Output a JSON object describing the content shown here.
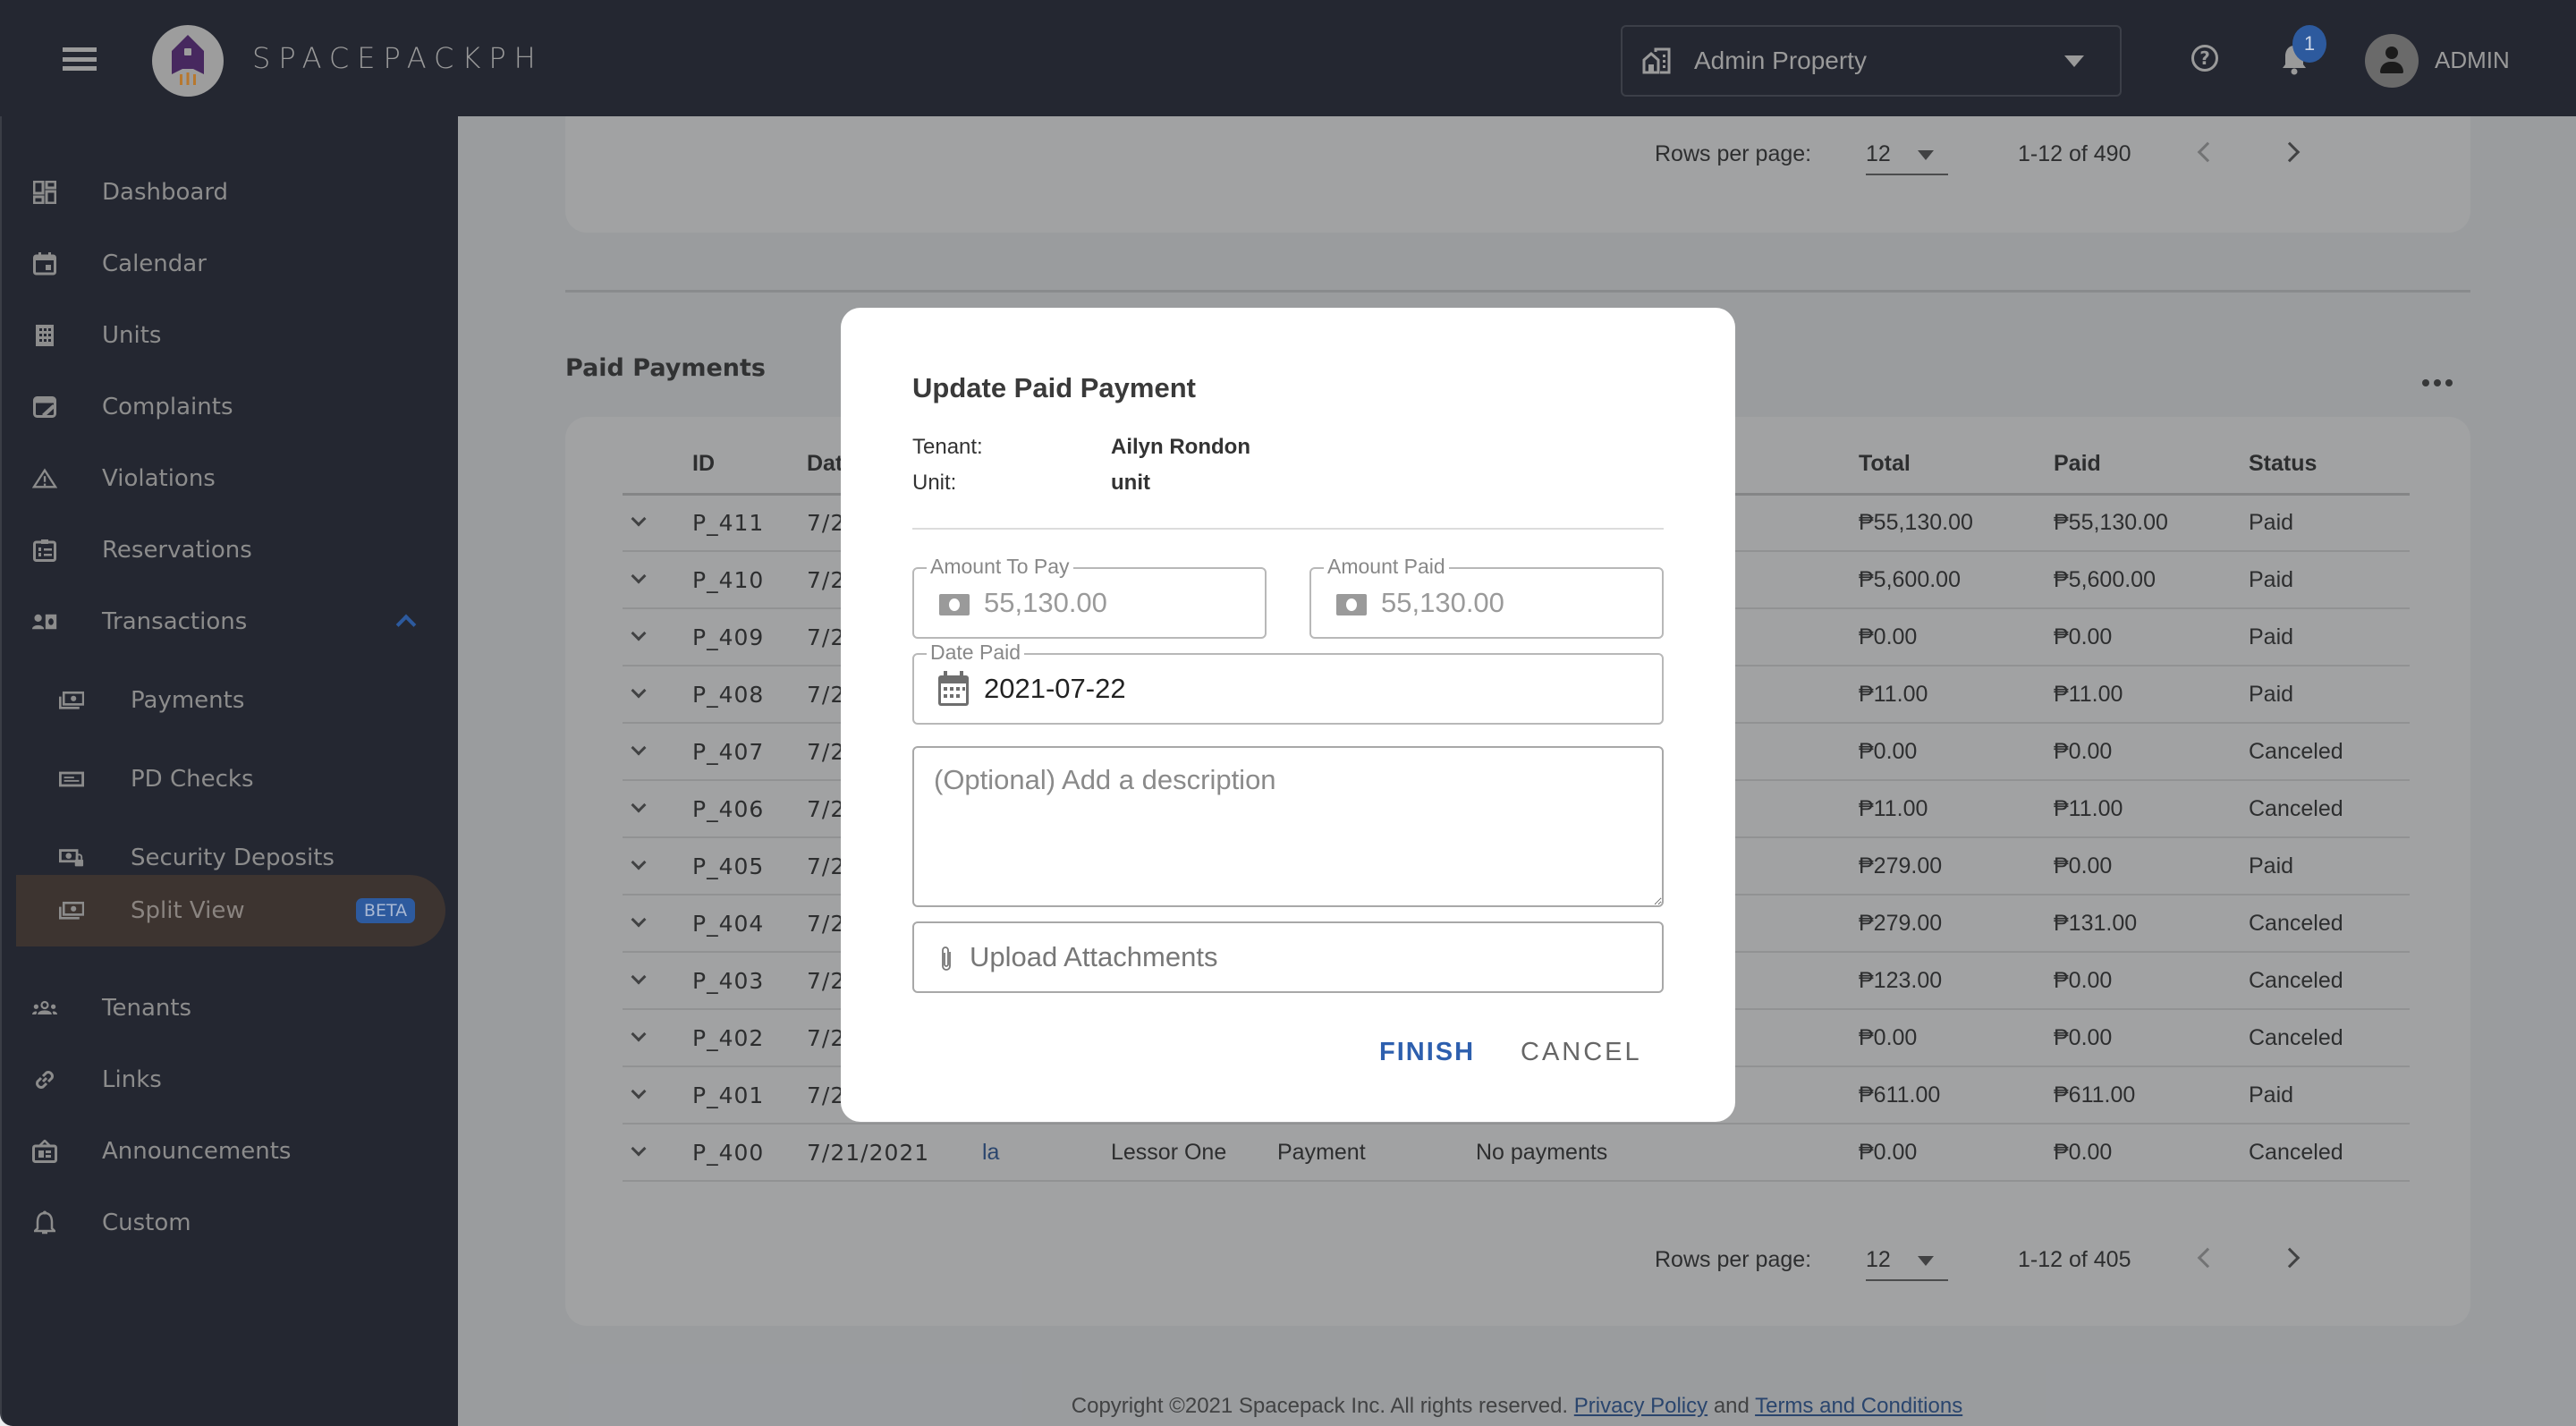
{
  "header": {
    "brand": "SPACEPACKPH",
    "property_selector": "Admin Property",
    "help_icon": "help-circle-icon",
    "notification_count": "1",
    "user_label": "ADMIN"
  },
  "sidebar": {
    "items": [
      {
        "label": "Dashboard",
        "icon": "dashboard-icon"
      },
      {
        "label": "Calendar",
        "icon": "calendar-icon"
      },
      {
        "label": "Units",
        "icon": "building-icon"
      },
      {
        "label": "Complaints",
        "icon": "edit-note-icon"
      },
      {
        "label": "Violations",
        "icon": "warning-icon"
      },
      {
        "label": "Reservations",
        "icon": "clipboard-list-icon"
      },
      {
        "label": "Transactions",
        "icon": "person-cash-icon",
        "expanded": true
      },
      {
        "label": "Payments",
        "icon": "cash-stack-icon",
        "sub": true
      },
      {
        "label": "PD Checks",
        "icon": "check-card-icon",
        "sub": true
      },
      {
        "label": "Security Deposits",
        "icon": "cash-lock-icon",
        "sub": true
      },
      {
        "label": "Split View",
        "icon": "cash-stack-icon",
        "sub": true,
        "active": true,
        "badge": "BETA"
      },
      {
        "label": "Tenants",
        "icon": "group-icon"
      },
      {
        "label": "Links",
        "icon": "link-icon"
      },
      {
        "label": "Announcements",
        "icon": "board-icon"
      },
      {
        "label": "Custom",
        "icon": "bell-icon"
      }
    ]
  },
  "top_pagination": {
    "rows_per_page_label": "Rows per page:",
    "rows_per_page": "12",
    "range": "1-12 of 490"
  },
  "paid_payments": {
    "title": "Paid Payments",
    "columns": [
      "",
      "ID",
      "Dat",
      "",
      "",
      "",
      "",
      "Total",
      "Paid",
      "Status"
    ],
    "rows": [
      {
        "id": "P_411",
        "date": "7/2",
        "c3": "",
        "c4": "",
        "c5": "",
        "c6": "",
        "total": "₱55,130.00",
        "paid": "₱55,130.00",
        "status": "Paid"
      },
      {
        "id": "P_410",
        "date": "7/2",
        "c3": "",
        "c4": "",
        "c5": "",
        "c6": "",
        "total": "₱5,600.00",
        "paid": "₱5,600.00",
        "status": "Paid"
      },
      {
        "id": "P_409",
        "date": "7/2",
        "c3": "",
        "c4": "",
        "c5": "",
        "c6": "",
        "total": "₱0.00",
        "paid": "₱0.00",
        "status": "Paid"
      },
      {
        "id": "P_408",
        "date": "7/2",
        "c3": "",
        "c4": "",
        "c5": "",
        "c6": "",
        "total": "₱11.00",
        "paid": "₱11.00",
        "status": "Paid"
      },
      {
        "id": "P_407",
        "date": "7/2",
        "c3": "",
        "c4": "",
        "c5": "",
        "c6": "",
        "total": "₱0.00",
        "paid": "₱0.00",
        "status": "Canceled"
      },
      {
        "id": "P_406",
        "date": "7/2",
        "c3": "",
        "c4": "",
        "c5": "",
        "c6": "",
        "total": "₱11.00",
        "paid": "₱11.00",
        "status": "Canceled"
      },
      {
        "id": "P_405",
        "date": "7/2",
        "c3": "",
        "c4": "",
        "c5": "",
        "c6": "",
        "total": "₱279.00",
        "paid": "₱0.00",
        "status": "Paid"
      },
      {
        "id": "P_404",
        "date": "7/2",
        "c3": "",
        "c4": "",
        "c5": "",
        "c6": "",
        "total": "₱279.00",
        "paid": "₱131.00",
        "status": "Canceled"
      },
      {
        "id": "P_403",
        "date": "7/2",
        "c3": "",
        "c4": "",
        "c5": "",
        "c6": "",
        "total": "₱123.00",
        "paid": "₱0.00",
        "status": "Canceled"
      },
      {
        "id": "P_402",
        "date": "7/2",
        "c3": "",
        "c4": "",
        "c5": "",
        "c6": "",
        "total": "₱0.00",
        "paid": "₱0.00",
        "status": "Canceled"
      },
      {
        "id": "P_401",
        "date": "7/2",
        "c3": "",
        "c4": "",
        "c5": "",
        "c6": "",
        "total": "₱611.00",
        "paid": "₱611.00",
        "status": "Paid"
      },
      {
        "id": "P_400",
        "date": "7/21/2021",
        "c3": "la",
        "c4": "Lessor One",
        "c5": "Payment",
        "c6": "No payments",
        "total": "₱0.00",
        "paid": "₱0.00",
        "status": "Canceled"
      }
    ],
    "pagination": {
      "rows_per_page_label": "Rows per page:",
      "rows_per_page": "12",
      "range": "1-12 of 405"
    }
  },
  "footer": {
    "copyright": "Copyright ©2021 Spacepack Inc. All rights reserved.",
    "privacy": "Privacy Policy",
    "and": "and",
    "terms": "Terms and Conditions"
  },
  "modal": {
    "title": "Update Paid Payment",
    "tenant_label": "Tenant:",
    "tenant_value": "Ailyn Rondon",
    "unit_label": "Unit:",
    "unit_value": "unit",
    "amount_to_pay_label": "Amount To Pay",
    "amount_to_pay_value": "55,130.00",
    "amount_paid_label": "Amount Paid",
    "amount_paid_value": "55,130.00",
    "date_paid_label": "Date Paid",
    "date_paid_value": "2021-07-22",
    "description_placeholder": "(Optional) Add a description",
    "description_value": "",
    "upload_label": "Upload Attachments",
    "finish_label": "FINISH",
    "cancel_label": "CANCEL"
  },
  "colors": {
    "header_bg": "#242731",
    "accent": "#2d5a9e",
    "active_nav_bg": "#3d3430",
    "finish_text": "#2d5fae"
  }
}
